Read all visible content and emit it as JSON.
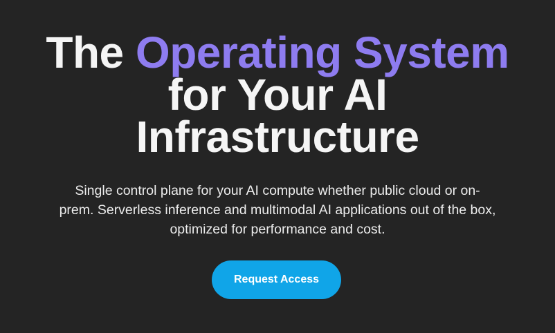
{
  "hero": {
    "headline": {
      "prefix": "The ",
      "accent": "Operating System",
      "line2": "for Your AI",
      "line3": "Infrastructure"
    },
    "subtitle_line1": "Single control plane for your AI compute whether public cloud or on-",
    "subtitle_line2": "prem. Serverless inference and multimodal AI applications out of the box,",
    "subtitle_line3": "optimized for performance and cost.",
    "cta_label": "Request Access"
  },
  "colors": {
    "background": "#242424",
    "accent": "#8e7cf0",
    "button": "#10a5e8",
    "text": "#f5f5f5"
  }
}
